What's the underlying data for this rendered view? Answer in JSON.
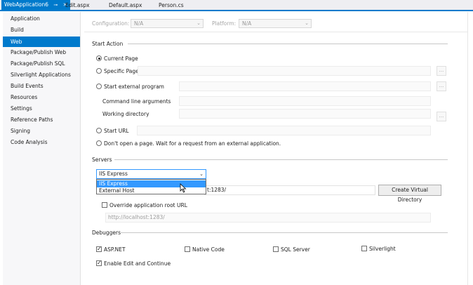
{
  "tabs": [
    {
      "label": "WebApplication6",
      "active": true
    },
    {
      "label": "Edit.aspx"
    },
    {
      "label": "Default.aspx"
    },
    {
      "label": "Person.cs"
    }
  ],
  "tab_icons": {
    "pin": "pin-icon",
    "close": "close-icon"
  },
  "sidebar": {
    "items": [
      {
        "label": "Application"
      },
      {
        "label": "Build"
      },
      {
        "label": "Web",
        "selected": true
      },
      {
        "label": "Package/Publish Web"
      },
      {
        "label": "Package/Publish SQL"
      },
      {
        "label": "Silverlight Applications"
      },
      {
        "label": "Build Events"
      },
      {
        "label": "Resources"
      },
      {
        "label": "Settings"
      },
      {
        "label": "Reference Paths"
      },
      {
        "label": "Signing"
      },
      {
        "label": "Code Analysis"
      }
    ]
  },
  "config": {
    "configuration_label": "Configuration:",
    "configuration_value": "N/A",
    "platform_label": "Platform:",
    "platform_value": "N/A"
  },
  "start_action": {
    "title": "Start Action",
    "current_page": "Current Page",
    "specific_page": "Specific Page",
    "external_program": "Start external program",
    "command_line": "Command line arguments",
    "working_directory": "Working directory",
    "start_url": "Start URL",
    "dont_open": "Don't open a page.  Wait for a request from an external application.",
    "browse_button": "..."
  },
  "servers": {
    "title": "Servers",
    "selected": "IIS Express",
    "options": [
      "IIS Express",
      "External Host"
    ],
    "project_url_suffix": "t:1283/",
    "create_vdir_button": "Create Virtual Directory",
    "override_root": "Override application root URL",
    "override_url": "http://localhost:1283/"
  },
  "debuggers": {
    "title": "Debuggers",
    "aspnet": "ASP.NET",
    "native": "Native Code",
    "sql": "SQL Server",
    "silverlight": "Silverlight",
    "edit_continue": "Enable Edit and Continue"
  },
  "colors": {
    "accent": "#007acc",
    "highlight": "#3399ff"
  }
}
